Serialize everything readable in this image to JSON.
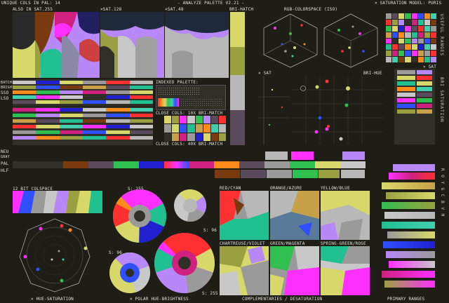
{
  "header": {
    "unique_cols": "UNIQUE COLS IN PAL: 14",
    "title": "- ANALYZE PALETTE V2.21 -",
    "sat_model": "× SATURATION MODEL: PURIS",
    "sat_sub": "ALSO IN SAT.255",
    "sat128": "×SAT.128",
    "sat48": "×SAT.48",
    "bri_hatch": "BRI-HATCH",
    "rgb_colorspace": "RGB-COLORSPACE (ISO)"
  },
  "side_labels": {
    "useful_ranges": "USEFUL RANGES",
    "bri_saturation": "BRI SATURATION",
    "roygcbvm": "R O Y G C B V M",
    "batch": "BATCH",
    "bright": "BRIGHT",
    "sso": "SSO",
    "lso": "LSO",
    "neu": "NEU",
    "gray": "GRAY",
    "pal": "PAL",
    "hlf": "HLF"
  },
  "mid_labels": {
    "indexed_palette": "INDEXED PALETTE:",
    "close_cols_10": "CLOSE COLS: 10X BRI-MATCH",
    "close_cols_40": "CLOSE COLS: 40X BRI-MATCH",
    "x_sat": "× SAT",
    "bri_hue": "BRI-HUE",
    "x_sat_right": "× SAT",
    "bit12": "12 BIT COLSPACE",
    "s255a": "S: 255",
    "s96a": "S: 96",
    "s96b": "S: 96",
    "s255b": "S: 255"
  },
  "complementaries": {
    "red_cyan": "RED/CYAN",
    "orange_azure": "ORANGE/AZURE",
    "yellow_blue": "YELLOW/BLUE",
    "chartreuse_violet": "CHARTREUSE/VIOLET",
    "green_magenta": "GREEN/MAGENTA",
    "spring_rose": "SPRING-GREEN/ROSE"
  },
  "footer": {
    "hue_sat": "× HUE-SATURATION",
    "polar": "× POLAR HUE-BRIGHTNESS",
    "comp_desat": "COMPLEMENTARIES / DESATURATION",
    "primary": "PRIMARY RANGES"
  },
  "palette": [
    "#000000",
    "#3a1f3a",
    "#5a4a5c",
    "#9a9a9a",
    "#ffffff",
    "#ff3030",
    "#ff8c1a",
    "#d8d86a",
    "#30c050",
    "#2020d0",
    "#ff30ff",
    "#40d0b0",
    "#c8a048",
    "#3050ff"
  ]
}
